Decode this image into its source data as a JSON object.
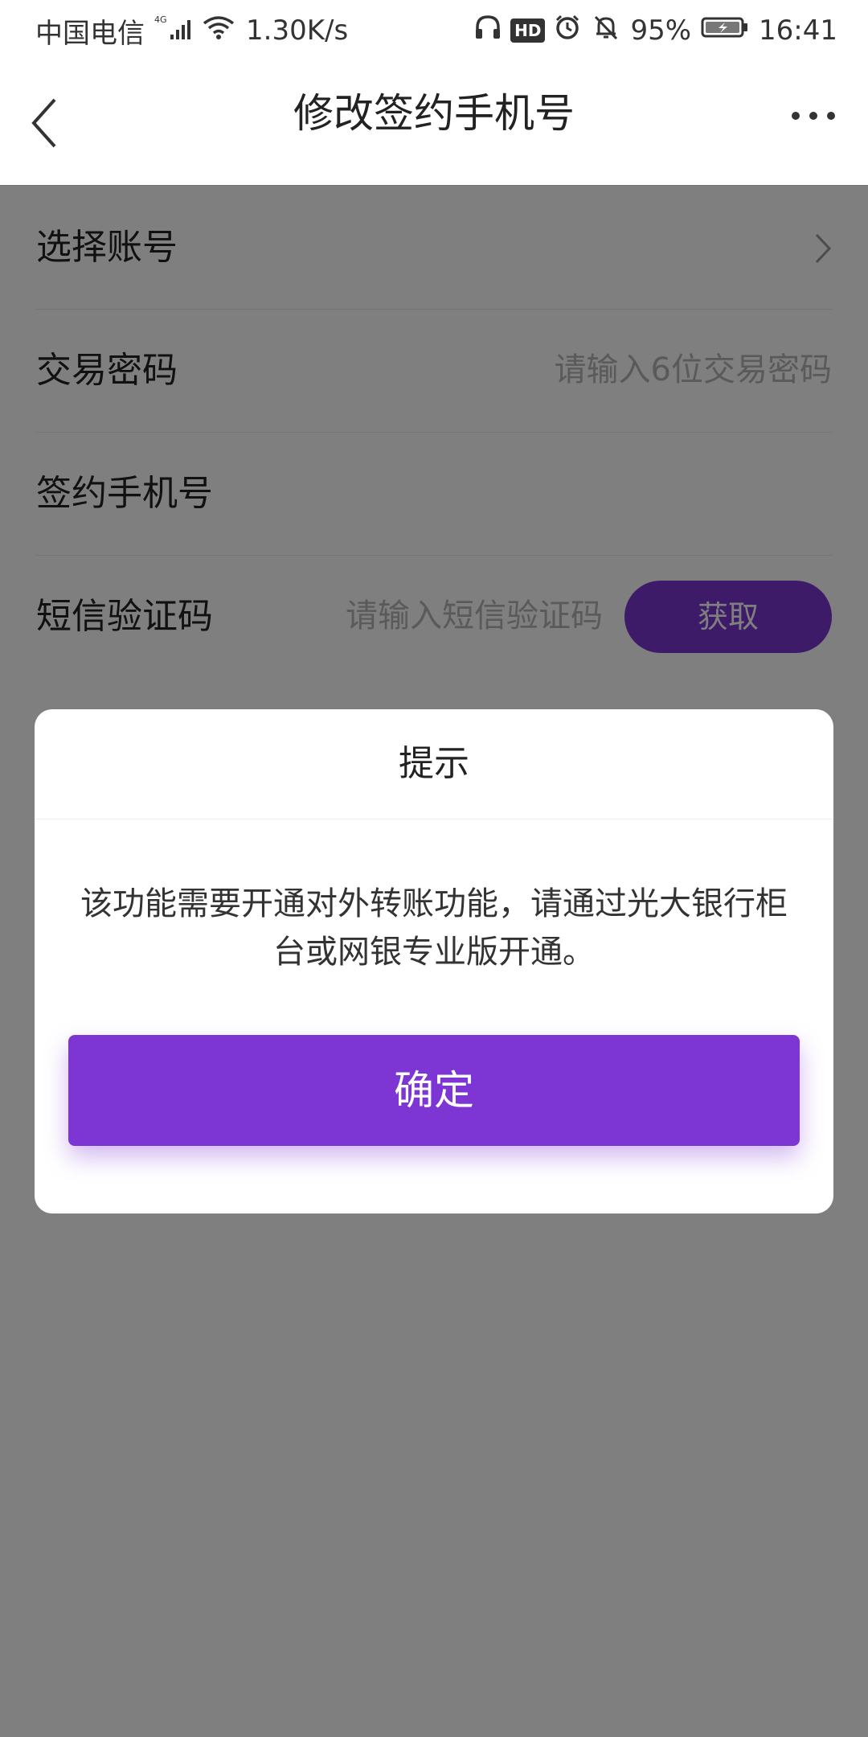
{
  "status_bar": {
    "carrier": "中国电信",
    "network_type": "4G",
    "speed": "1.30K/s",
    "hd_badge": "HD",
    "battery": "95%",
    "time": "16:41",
    "icons": [
      "signal-icon",
      "wifi-icon",
      "headphone-icon",
      "alarm-icon",
      "mute-icon",
      "battery-icon"
    ]
  },
  "nav": {
    "title": "修改签约手机号",
    "back_icon": "back-arrow-icon",
    "more_icon": "more-dots-icon"
  },
  "form": {
    "rows": [
      {
        "label": "选择账号"
      },
      {
        "label": "交易密码",
        "placeholder": "请输入6位交易密码"
      },
      {
        "label": "签约手机号"
      },
      {
        "label": "短信验证码",
        "placeholder": "请输入短信验证码",
        "button": "获取"
      }
    ]
  },
  "dialog": {
    "title": "提示",
    "message": "该功能需要开通对外转账功能，请通过光大银行柜台或网银专业版开通。",
    "confirm": "确定"
  },
  "colors": {
    "accent": "#7d36d3",
    "overlay": "rgba(0,0,0,0.5)"
  }
}
